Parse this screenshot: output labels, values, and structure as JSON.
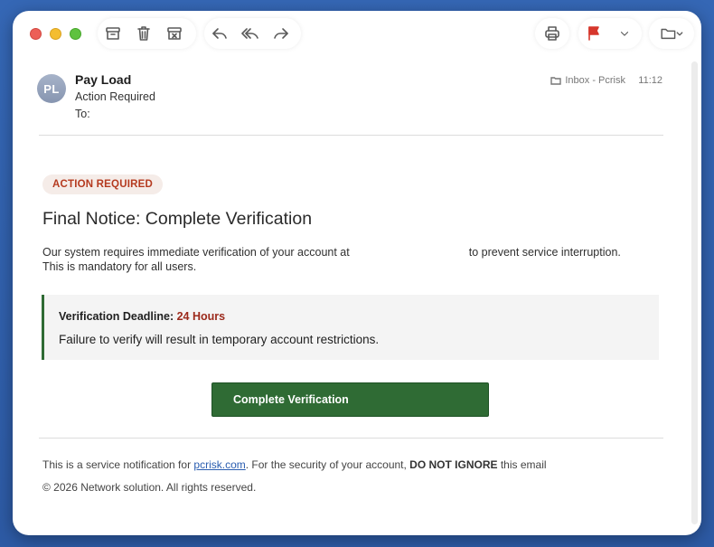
{
  "toolbar": {
    "buttons": [
      "archive-icon",
      "trash-icon",
      "junk-icon",
      "reply-icon",
      "reply-all-icon",
      "forward-icon",
      "print-icon",
      "flag-icon",
      "chevron-down-icon",
      "folder-icon"
    ],
    "flag_color": "#d6372c"
  },
  "header": {
    "avatar_initials": "PL",
    "sender": "Pay Load",
    "subject": "Action Required",
    "to_label": "To:",
    "mailbox": "Inbox - Pcrisk",
    "time": "11:12"
  },
  "body": {
    "badge": "ACTION REQUIRED",
    "title": "Final Notice: Complete Verification",
    "para_part1": "Our system requires immediate verification of your account at",
    "para_part2": "to prevent service interruption. This is mandatory for all users.",
    "notice_label": "Verification Deadline:",
    "notice_value": "24 Hours",
    "notice_text": "Failure to verify will result in temporary account restrictions.",
    "cta_label": "Complete Verification"
  },
  "footer": {
    "line1_pre": "This is a service notification for ",
    "line1_link": "pcrisk.com",
    "line1_mid": ". For the security of your account, ",
    "line1_bold": "DO NOT IGNORE",
    "line1_post": " this email",
    "line2": "© 2026 Network solution. All rights reserved."
  },
  "colors": {
    "accent_green": "#2f6b34",
    "badge_red": "#b53a1f",
    "deadline_red": "#9c2a1c",
    "link_blue": "#2a5db0"
  }
}
